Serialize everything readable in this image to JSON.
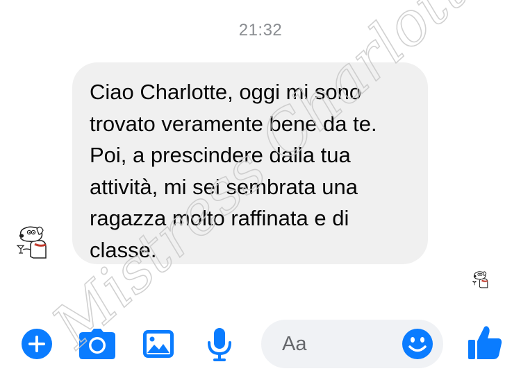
{
  "conversation": {
    "timestamp": "21:32",
    "message": {
      "lines": [
        "Ciao Charlotte, oggi mi sono",
        "trovato veramente bene da te.",
        "Poi, a prescindere dalla tua",
        "attività, mi sei sembrata una",
        "ragazza molto raffinata e di",
        "classe."
      ]
    }
  },
  "composer": {
    "placeholder": "Aa",
    "value": ""
  },
  "toolbar": {
    "icons": [
      "plus-icon",
      "camera-icon",
      "gallery-icon",
      "microphone-icon",
      "emoji-icon",
      "thumbs-up-icon"
    ]
  },
  "watermark": {
    "text": "Mistress Charlotte"
  },
  "colors": {
    "accent": "#0a7cff",
    "bubble": "#f0f0f0",
    "timestamp": "#8a8d91",
    "composer_bg": "#f0f2f5",
    "text": "#050505"
  }
}
